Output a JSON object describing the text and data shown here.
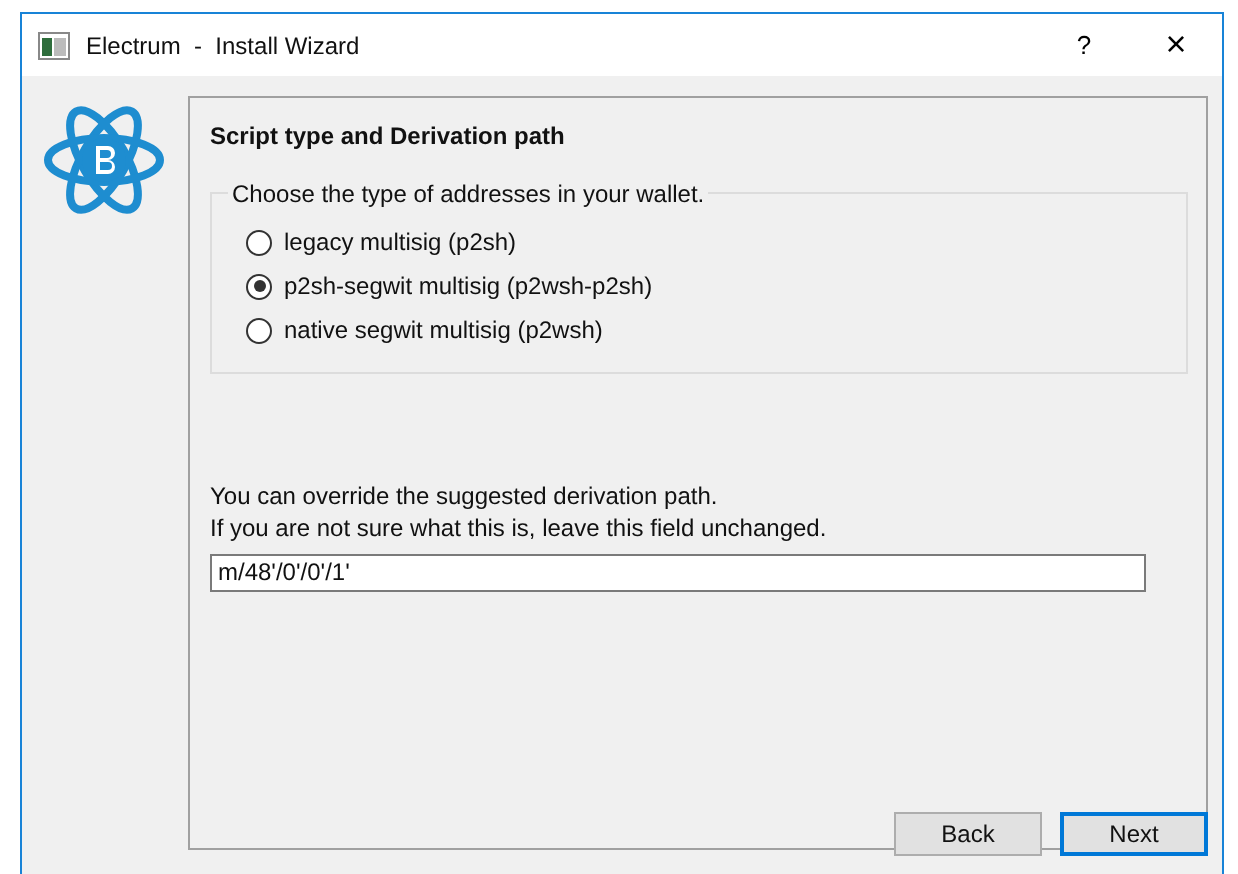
{
  "window": {
    "title": "Electrum  -  Install Wizard",
    "help": "?",
    "close": "×"
  },
  "page": {
    "heading": "Script type and Derivation path",
    "group_title": "Choose the type of addresses in your wallet.",
    "options": [
      {
        "label": "legacy multisig (p2sh)",
        "selected": false
      },
      {
        "label": "p2sh-segwit multisig (p2wsh-p2sh)",
        "selected": true
      },
      {
        "label": "native segwit multisig (p2wsh)",
        "selected": false
      }
    ],
    "hint_lines": [
      "You can override the suggested derivation path.",
      "If you are not sure what this is, leave this field unchanged."
    ],
    "path_field": {
      "value": "m/48'/0'/0'/1'"
    }
  },
  "buttons": [
    {
      "label": "Back",
      "default": false
    },
    {
      "label": "Next",
      "default": true
    }
  ]
}
